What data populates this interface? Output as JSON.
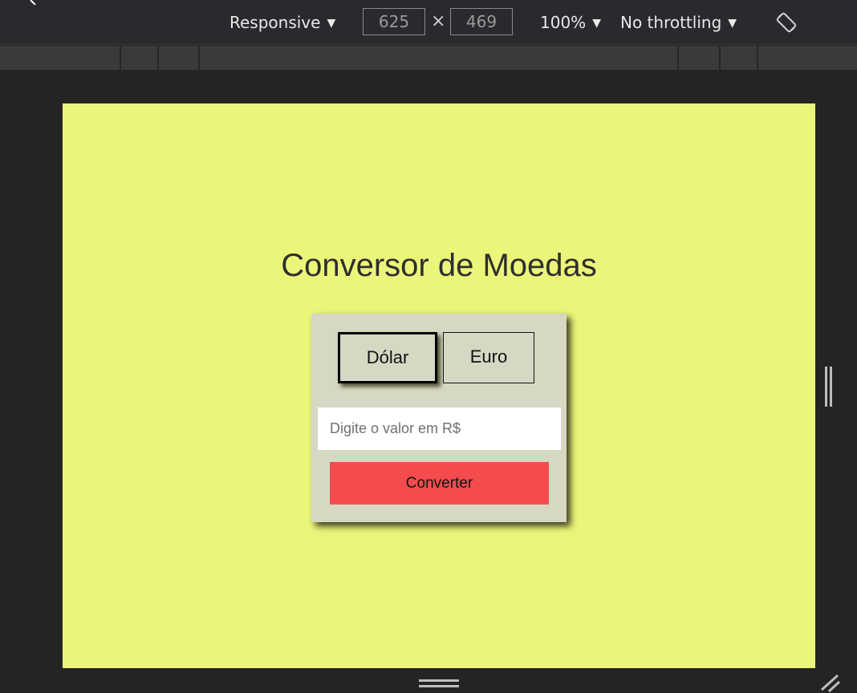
{
  "devtools": {
    "device_mode": "Responsive",
    "width": "625",
    "height": "469",
    "dim_separator": "×",
    "zoom": "100%",
    "throttling": "No throttling",
    "caret": "▼"
  },
  "page": {
    "title": "Conversor de Moedas",
    "buttons": {
      "dollar": "Dólar",
      "euro": "Euro"
    },
    "amount_placeholder": "Digite o valor em R$",
    "convert_label": "Converter"
  },
  "colors": {
    "page_background": "#ebf57a",
    "card_background": "#d6d8c3",
    "convert_button": "#f44c4e"
  },
  "icons": {
    "rotate": "rotate-icon",
    "resize_right": "resize-handle-right-icon",
    "resize_bottom": "resize-handle-bottom-icon",
    "resize_corner": "resize-corner-icon"
  }
}
